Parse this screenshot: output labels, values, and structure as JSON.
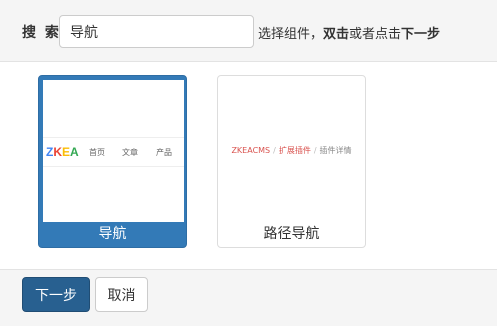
{
  "search": {
    "label": "搜 索",
    "value": "导航",
    "hint_pre": "选择组件，",
    "hint_bold1": "双击",
    "hint_mid": "或者点击",
    "hint_bold2": "下一步"
  },
  "cards": [
    {
      "title": "导航",
      "selected": true,
      "preview": {
        "logo": "ZKEA",
        "logo_colors": [
          "#4285f4",
          "#ea4335",
          "#fbbc05",
          "#34a853"
        ],
        "nav_items": [
          "首页",
          "文章",
          "产品"
        ]
      }
    },
    {
      "title": "路径导航",
      "selected": false,
      "preview": {
        "breadcrumb": [
          "ZKEACMS",
          "扩展插件",
          "插件详情"
        ],
        "separator": "/"
      }
    }
  ],
  "footer": {
    "next_label": "下一步",
    "cancel_label": "取消"
  },
  "colors": {
    "primary": "#337ab7",
    "primary_dark": "#286090",
    "breadcrumb_link": "#d9534f"
  }
}
